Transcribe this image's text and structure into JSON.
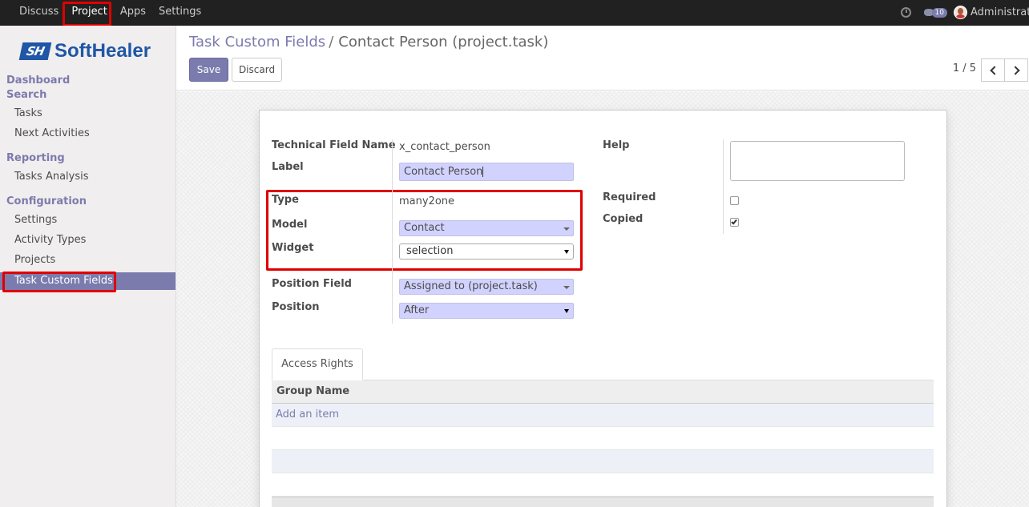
{
  "topbar": {
    "menu": [
      "Discuss",
      "Project",
      "Apps",
      "Settings"
    ],
    "active": "Project",
    "chat_count": "10",
    "user": "Administrator",
    "icons": [
      "clock-icon",
      "chat-icon",
      "avatar"
    ]
  },
  "sidebar": {
    "logo_mark": "SH",
    "logo_text": "SoftHealer",
    "sections": {
      "dashboard": "Dashboard",
      "search": "Search",
      "reporting": "Reporting",
      "configuration": "Configuration"
    },
    "items": {
      "tasks": "Tasks",
      "next_activities": "Next Activities",
      "tasks_analysis": "Tasks Analysis",
      "settings": "Settings",
      "activity_types": "Activity Types",
      "projects": "Projects",
      "task_custom_fields": "Task Custom Fields"
    },
    "active_item": "Task Custom Fields"
  },
  "control": {
    "breadcrumb_parent": "Task Custom Fields",
    "breadcrumb_sep": "/",
    "breadcrumb_current": "Contact Person (project.task)",
    "save_label": "Save",
    "discard_label": "Discard",
    "pager": "1 / 5"
  },
  "form": {
    "technical_field_name_label": "Technical Field Name",
    "technical_field_name": "x_contact_person",
    "label_label": "Label",
    "label_value": "Contact Person",
    "type_label": "Type",
    "type_value": "many2one",
    "model_label": "Model",
    "model_value": "Contact",
    "widget_label": "Widget",
    "widget_value": "selection",
    "position_field_label": "Position Field",
    "position_field_value": "Assigned to (project.task)",
    "position_label": "Position",
    "position_value": "After",
    "help_label": "Help",
    "required_label": "Required",
    "required_checked": false,
    "copied_label": "Copied",
    "copied_checked": true
  },
  "tabs": {
    "access_rights": "Access Rights"
  },
  "table": {
    "header": "Group Name",
    "add_item": "Add an item"
  },
  "colors": {
    "accent": "#7c7bad",
    "highlight": "#e00000",
    "input_bg": "#d2d2ff"
  }
}
